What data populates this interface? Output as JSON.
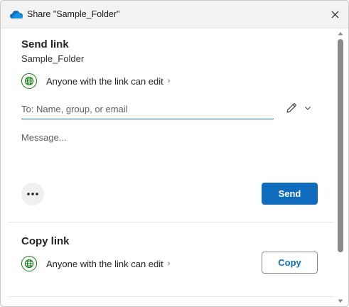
{
  "window": {
    "title": "Share \"Sample_Folder\"",
    "icon": "onedrive-cloud-icon",
    "close_icon": "close-icon"
  },
  "send_link": {
    "heading": "Send link",
    "item_name": "Sample_Folder",
    "permission_text": "Anyone with the link can edit",
    "permission_chevron": "›",
    "to_placeholder": "To: Name, group, or email",
    "message_placeholder": "Message...",
    "send_label": "Send"
  },
  "copy_link": {
    "heading": "Copy link",
    "permission_text": "Anyone with the link can edit",
    "permission_chevron": "›",
    "copy_label": "Copy"
  },
  "colors": {
    "accent": "#0f6cbd",
    "globe_green": "#107c10"
  }
}
